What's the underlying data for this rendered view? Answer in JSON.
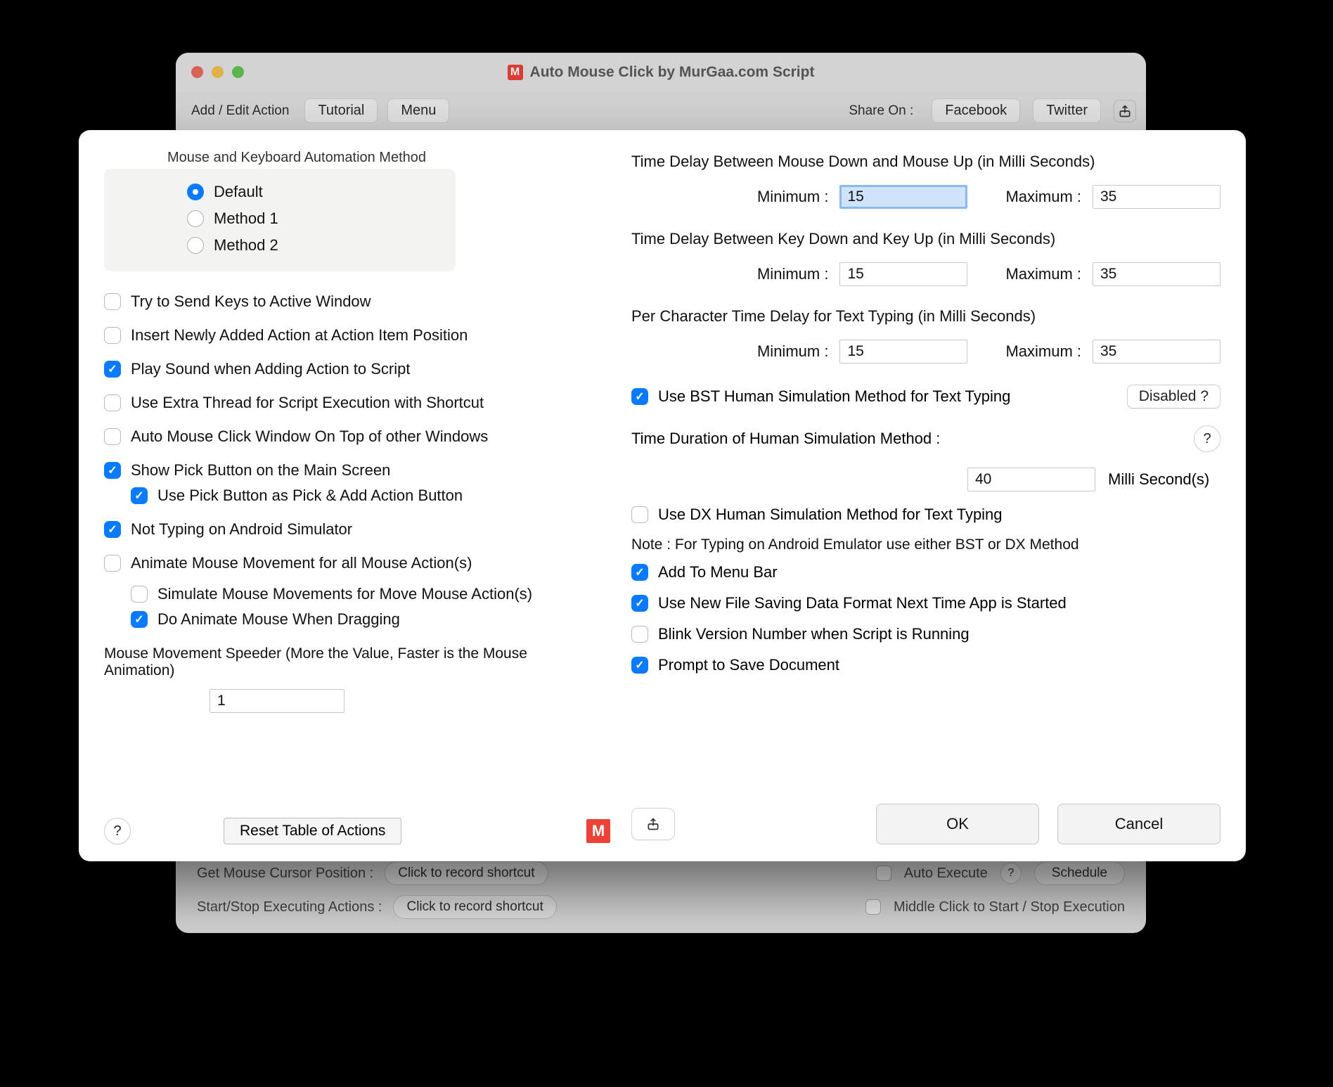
{
  "bgWindow": {
    "title": "Auto Mouse Click by MurGaa.com Script",
    "addEdit": "Add / Edit Action",
    "tutorial": "Tutorial",
    "menu": "Menu",
    "shareOn": "Share On :",
    "facebook": "Facebook",
    "twitter": "Twitter",
    "bottom": {
      "getCursorLabel": "Get Mouse Cursor Position :",
      "startStopLabel": "Start/Stop Executing Actions :",
      "recordShortcut": "Click to record shortcut",
      "autoExecute": "Auto Execute",
      "schedule": "Schedule",
      "middleClick": "Middle Click to Start / Stop Execution"
    }
  },
  "modal": {
    "method": {
      "title": "Mouse and Keyboard Automation Method",
      "opt1": "Default",
      "opt2": "Method 1",
      "opt3": "Method 2"
    },
    "leftChecks": {
      "sendKeys": "Try to Send Keys to Active Window",
      "insertNew": "Insert Newly Added Action at Action Item Position",
      "playSound": "Play Sound when Adding Action to Script",
      "extraThread": "Use Extra Thread for Script Execution with Shortcut",
      "onTop": "Auto Mouse Click Window On Top of other Windows",
      "showPick": "Show Pick Button on the Main Screen",
      "pickAdd": "Use Pick Button as Pick & Add Action Button",
      "notAndroid": "Not Typing on Android Simulator",
      "animateAll": "Animate Mouse Movement for all Mouse Action(s)",
      "simMove": "Simulate Mouse Movements for Move Mouse Action(s)",
      "animateDrag": "Do Animate Mouse When Dragging",
      "speederLabel": "Mouse Movement Speeder (More the Value, Faster is the Mouse Animation)",
      "speederValue": "1",
      "reset": "Reset Table of Actions"
    },
    "right": {
      "mouseDelayTitle": "Time Delay Between Mouse Down and Mouse Up (in Milli Seconds)",
      "keyDelayTitle": "Time Delay Between Key Down and Key Up (in Milli Seconds)",
      "charDelayTitle": "Per Character Time Delay  for Text Typing (in Milli Seconds)",
      "minLabel": "Minimum :",
      "maxLabel": "Maximum :",
      "mouseMin": "15",
      "mouseMax": "35",
      "keyMin": "15",
      "keyMax": "35",
      "charMin": "15",
      "charMax": "35",
      "useBST": "Use BST Human Simulation Method for Text Typing",
      "disabled": "Disabled ?",
      "hsDurationLabel": "Time Duration of Human Simulation Method :",
      "hsUnit": "Milli Second(s)",
      "hsValue": "40",
      "useDX": "Use DX Human Simulation Method for Text Typing",
      "note": "Note : For Typing on Android Emulator use either BST or DX Method",
      "addMenuBar": "Add To Menu Bar",
      "newFile": "Use New File Saving Data Format Next Time App is Started",
      "blink": "Blink Version Number when Script is Running",
      "prompt": "Prompt to Save Document",
      "ok": "OK",
      "cancel": "Cancel"
    }
  }
}
